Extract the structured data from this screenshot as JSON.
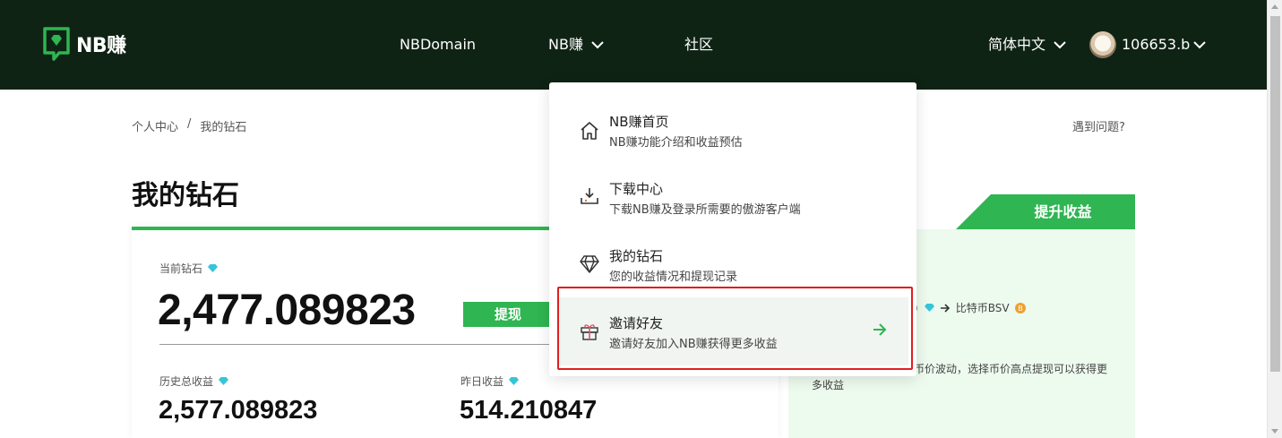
{
  "brand": {
    "name": "NB赚"
  },
  "nav": {
    "domain": "NBDomain",
    "earn": "NB赚",
    "community": "社区",
    "language": "简体中文",
    "user": "106653.b"
  },
  "breadcrumb": {
    "home": "个人中心",
    "sep": "/",
    "current": "我的钻石"
  },
  "help": "遇到问题?",
  "page_title": "我的钻石",
  "balance": {
    "current_label": "当前钻石",
    "current_value": "2,477.089823",
    "withdraw_label": "提现",
    "total_label": "历史总收益",
    "total_value": "2,577.089823",
    "yesterday_label": "昨日收益",
    "yesterday_value": "514.210847"
  },
  "side": {
    "tab_label": "提升收益",
    "conversion_left": ")",
    "conversion_right": "比特币BSV",
    "note_line1": "币价波动，选择币价高点提现可以获得更",
    "note_line2": "多收益"
  },
  "dropdown": {
    "items": [
      {
        "title": "NB赚首页",
        "desc": "NB赚功能介绍和收益预估"
      },
      {
        "title": "下载中心",
        "desc": "下载NB赚及登录所需要的傲游客户端"
      },
      {
        "title": "我的钻石",
        "desc": "您的收益情况和提现记录"
      },
      {
        "title": "邀请好友",
        "desc": "邀请好友加入NB赚获得更多收益"
      }
    ]
  },
  "colors": {
    "nav_bg": "#0f2315",
    "accent": "#2fb552",
    "highlight": "#e01e1e"
  }
}
